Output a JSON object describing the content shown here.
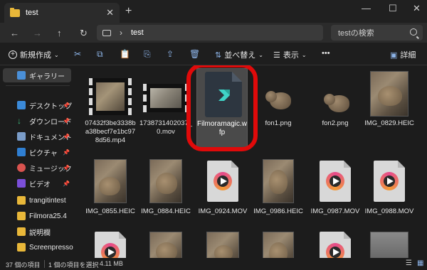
{
  "window": {
    "tab_title": "test",
    "new_tab": "+",
    "close_tab": "✕",
    "minimize": "—",
    "maximize": "☐",
    "close": "✕"
  },
  "address": {
    "back": "←",
    "forward": "→",
    "up": "↑",
    "refresh": "↻",
    "chevron": "›",
    "path": "test",
    "search_placeholder": "testの検索"
  },
  "toolbar": {
    "new_label": "新規作成",
    "sort_label": "並べ替え",
    "view_label": "表示",
    "more_label": "•••",
    "details_label": "詳細"
  },
  "sidebar": {
    "items": [
      {
        "label": "ギャラリー",
        "icon": "gallery-icon",
        "pinned": false
      },
      {
        "label": "デスクトップ",
        "icon": "desktop-icon",
        "pinned": true
      },
      {
        "label": "ダウンロード",
        "icon": "download-icon",
        "pinned": true
      },
      {
        "label": "ドキュメント",
        "icon": "document-icon",
        "pinned": true
      },
      {
        "label": "ピクチャ",
        "icon": "picture-icon",
        "pinned": true
      },
      {
        "label": "ミュージック",
        "icon": "music-icon",
        "pinned": true
      },
      {
        "label": "ビデオ",
        "icon": "video-icon",
        "pinned": true
      },
      {
        "label": "trangitintest",
        "icon": "folder-icon",
        "pinned": false
      },
      {
        "label": "Filmora25.4",
        "icon": "folder-icon",
        "pinned": false
      },
      {
        "label": "説明欄",
        "icon": "folder-icon",
        "pinned": false
      },
      {
        "label": "Screenpresso",
        "icon": "folder-icon",
        "pinned": false
      }
    ]
  },
  "files": [
    {
      "name": "07432f3be3338ba38becf7e1bc978d56.mp4",
      "kind": "video"
    },
    {
      "name": "1738731402037_0.mov",
      "kind": "video"
    },
    {
      "name": "Filmoramagic.wfp",
      "kind": "wfp",
      "selected": true
    },
    {
      "name": "fon1.png",
      "kind": "png"
    },
    {
      "name": "fon2.png",
      "kind": "png"
    },
    {
      "name": "IMG_0829.HEIC",
      "kind": "photo"
    },
    {
      "name": "IMG_0855.HEIC",
      "kind": "photo"
    },
    {
      "name": "IMG_0884.HEIC",
      "kind": "photo"
    },
    {
      "name": "IMG_0924.MOV",
      "kind": "mov"
    },
    {
      "name": "IMG_0986.HEIC",
      "kind": "photo"
    },
    {
      "name": "IMG_0987.MOV",
      "kind": "mov"
    },
    {
      "name": "IMG_0988.MOV",
      "kind": "mov"
    }
  ],
  "status": {
    "item_count": "37 個の項目",
    "selection": "1 個の項目を選択",
    "size": "4.11 MB"
  },
  "colors": {
    "highlight_ring": "#e00a0a",
    "accent": "#8db4e8",
    "folder": "#e8b739"
  }
}
